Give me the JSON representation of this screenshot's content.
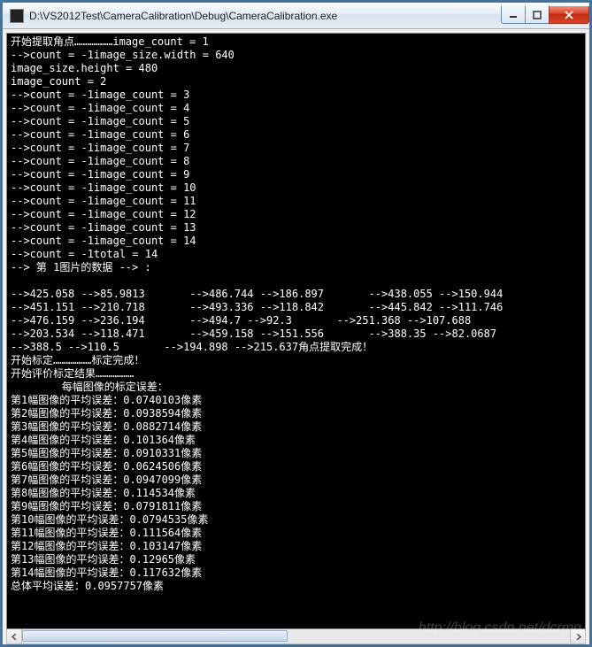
{
  "window": {
    "title": "D:\\VS2012Test\\CameraCalibration\\Debug\\CameraCalibration.exe"
  },
  "console": {
    "lines": [
      "开始提取角点………………image_count = 1",
      "-->count = -1image_size.width = 640",
      "image_size.height = 480",
      "image_count = 2",
      "-->count = -1image_count = 3",
      "-->count = -1image_count = 4",
      "-->count = -1image_count = 5",
      "-->count = -1image_count = 6",
      "-->count = -1image_count = 7",
      "-->count = -1image_count = 8",
      "-->count = -1image_count = 9",
      "-->count = -1image_count = 10",
      "-->count = -1image_count = 11",
      "-->count = -1image_count = 12",
      "-->count = -1image_count = 13",
      "-->count = -1image_count = 14",
      "-->count = -1total = 14",
      "--> 第 1图片的数据 --> :",
      "",
      "-->425.058 -->85.9813       -->486.744 -->186.897       -->438.055 -->150.944",
      "-->451.151 -->210.718       -->493.336 -->118.842       -->445.842 -->111.746",
      "-->476.159 -->236.194       -->494.7 -->92.3       -->251.368 -->107.688",
      "-->203.534 -->118.471       -->459.158 -->151.556       -->388.35 -->82.0687",
      "-->388.5 -->110.5       -->194.898 -->215.637角点提取完成！",
      "开始标定………………标定完成！",
      "开始评价标定结果………………",
      "        每幅图像的标定误差：",
      "第1幅图像的平均误差：0.0740103像素",
      "第2幅图像的平均误差：0.0938594像素",
      "第3幅图像的平均误差：0.0882714像素",
      "第4幅图像的平均误差：0.101364像素",
      "第5幅图像的平均误差：0.0910331像素",
      "第6幅图像的平均误差：0.0624506像素",
      "第7幅图像的平均误差：0.0947099像素",
      "第8幅图像的平均误差：0.114534像素",
      "第9幅图像的平均误差：0.0791811像素",
      "第10幅图像的平均误差：0.0794535像素",
      "第11幅图像的平均误差：0.111564像素",
      "第12幅图像的平均误差：0.103147像素",
      "第13幅图像的平均误差：0.12965像素",
      "第14幅图像的平均误差：0.117632像素",
      "总体平均误差：0.0957757像素"
    ]
  },
  "watermark": "http://blog.csdn.net/dcrmg"
}
